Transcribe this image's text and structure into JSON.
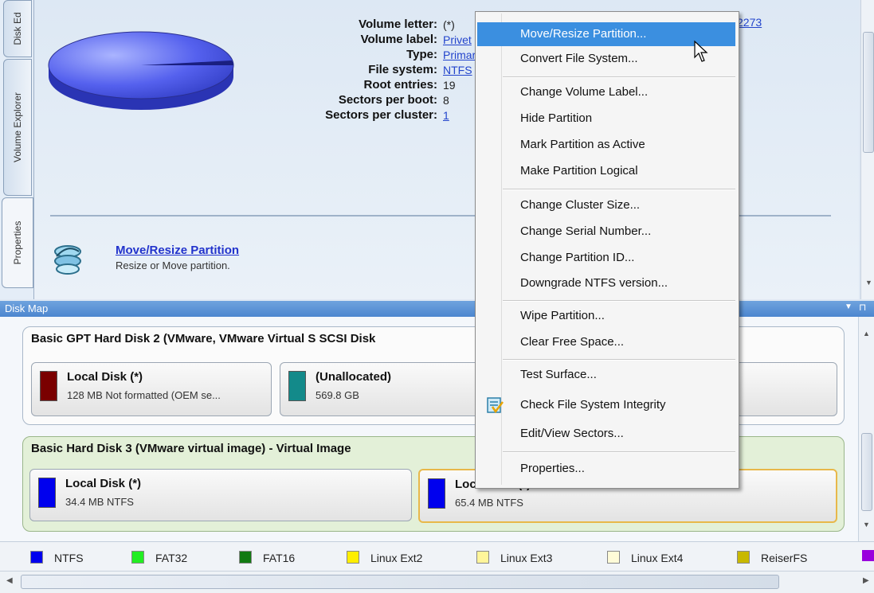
{
  "tabs": [
    {
      "label": "Disk Ed"
    },
    {
      "label": "Volume Explorer"
    },
    {
      "label": "Properties"
    }
  ],
  "properties": {
    "rows": [
      {
        "label": "Volume letter:",
        "value": "(*)",
        "link": false
      },
      {
        "label": "Volume label:",
        "value": "Privet",
        "link": true
      },
      {
        "label": "Type:",
        "value": "Primary",
        "link": true
      },
      {
        "label": "File system:",
        "value": "NTFS",
        "link": true
      },
      {
        "label": "Root entries:",
        "value": "19",
        "link": false
      },
      {
        "label": "Sectors per boot:",
        "value": "8",
        "link": false
      },
      {
        "label": "Sectors per cluster:",
        "value": "1",
        "link": true
      }
    ],
    "partial_link": "2273",
    "action": {
      "title": "Move/Resize Partition",
      "desc": "Resize or Move partition."
    }
  },
  "disk_map": {
    "header": "Disk Map",
    "disks": [
      {
        "title": "Basic GPT Hard Disk 2 (VMware, VMware Virtual S SCSI Disk",
        "partitions": [
          {
            "name": "Local Disk (*)",
            "info": "128 MB Not formatted (OEM se...",
            "color": "#7a0000"
          },
          {
            "name": "(Unallocated)",
            "info": "569.8 GB",
            "color": "#138a8a"
          }
        ]
      },
      {
        "title": "Basic Hard Disk 3 (VMware virtual image) - Virtual Image",
        "partitions": [
          {
            "name": "Local Disk (*)",
            "info": "34.4 MB NTFS",
            "color": "#0000ee"
          },
          {
            "name": "Local Disk (*)",
            "info": "65.4 MB NTFS",
            "color": "#0000ee"
          }
        ]
      }
    ]
  },
  "legend": [
    {
      "label": "NTFS",
      "color": "#0000ee"
    },
    {
      "label": "FAT32",
      "color": "#22ee22"
    },
    {
      "label": "FAT16",
      "color": "#127a12"
    },
    {
      "label": "Linux Ext2",
      "color": "#ffee00"
    },
    {
      "label": "Linux Ext3",
      "color": "#fff59a"
    },
    {
      "label": "Linux Ext4",
      "color": "#fffbd8"
    },
    {
      "label": "ReiserFS",
      "color": "#c8b800"
    }
  ],
  "menu": {
    "items": [
      "Move/Resize Partition...",
      "Convert File System...",
      "Change Volume Label...",
      "Hide Partition",
      "Mark Partition as Active",
      "Make Partition Logical",
      "Change Cluster Size...",
      "Change Serial Number...",
      "Change Partition ID...",
      "Downgrade NTFS version...",
      "Wipe Partition...",
      "Clear Free Space...",
      "Test Surface...",
      "Check File System Integrity",
      "Edit/View Sectors...",
      "Properties..."
    ],
    "highlighted_index": 0
  }
}
